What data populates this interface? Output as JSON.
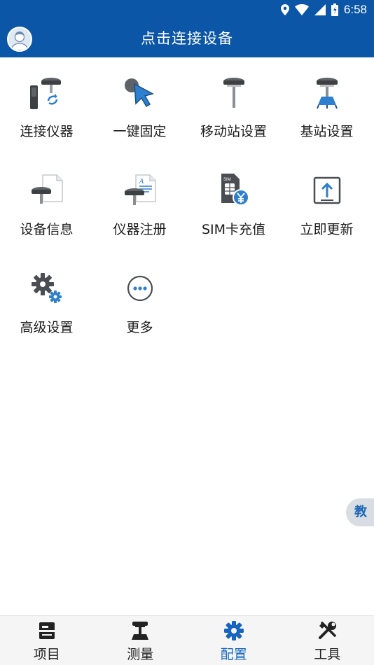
{
  "status_bar": {
    "time": "6:58"
  },
  "header": {
    "title": "点击连接设备"
  },
  "grid": {
    "items": [
      {
        "label": "连接仪器",
        "icon": "connect-device-icon"
      },
      {
        "label": "一键固定",
        "icon": "one-click-fix-icon"
      },
      {
        "label": "移动站设置",
        "icon": "rover-settings-icon"
      },
      {
        "label": "基站设置",
        "icon": "base-station-settings-icon"
      },
      {
        "label": "设备信息",
        "icon": "device-info-icon"
      },
      {
        "label": "仪器注册",
        "icon": "device-register-icon"
      },
      {
        "label": "SIM卡充值",
        "icon": "sim-recharge-icon"
      },
      {
        "label": "立即更新",
        "icon": "update-now-icon"
      },
      {
        "label": "高级设置",
        "icon": "advanced-settings-icon"
      },
      {
        "label": "更多",
        "icon": "more-icon"
      }
    ]
  },
  "float_tab": {
    "label": "教"
  },
  "bottom_nav": {
    "active": "配置",
    "items": [
      {
        "label": "项目",
        "icon": "project-icon"
      },
      {
        "label": "测量",
        "icon": "survey-icon"
      },
      {
        "label": "配置",
        "icon": "config-gear-icon"
      },
      {
        "label": "工具",
        "icon": "tools-icon"
      }
    ]
  },
  "colors": {
    "primary": "#0b56a6",
    "accent": "#1565c0",
    "icon_gray": "#3c4043",
    "icon_blue": "#2f7fd0"
  }
}
